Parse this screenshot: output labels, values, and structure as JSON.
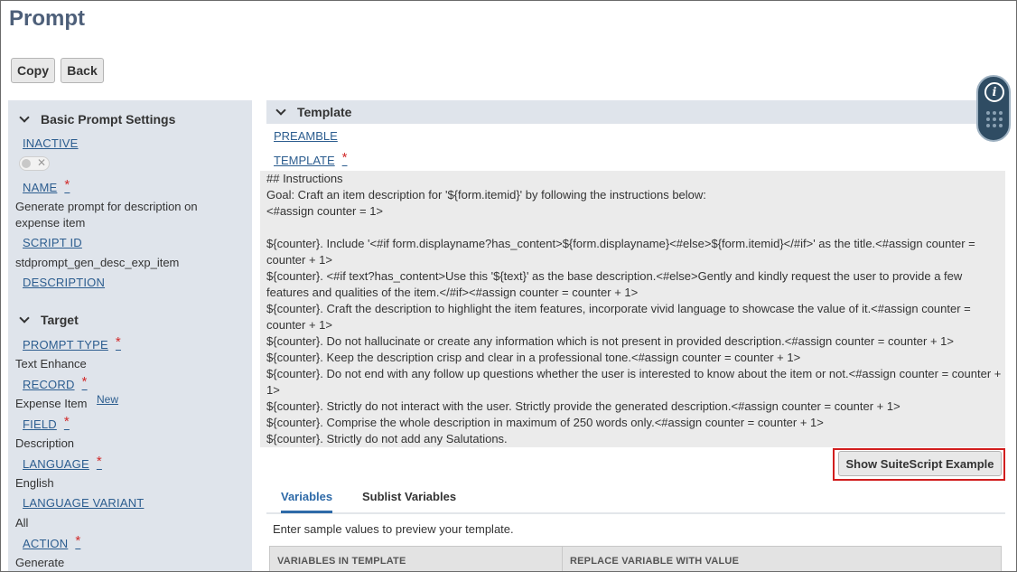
{
  "page": {
    "title": "Prompt"
  },
  "toolbar": {
    "copy_label": "Copy",
    "back_label": "Back"
  },
  "basic": {
    "heading": "Basic Prompt Settings",
    "inactive_label": "INACTIVE",
    "name_label": "NAME",
    "name_value": "Generate prompt for description on expense item",
    "script_id_label": "SCRIPT ID",
    "script_id_value": "stdprompt_gen_desc_exp_item",
    "description_label": "DESCRIPTION"
  },
  "target": {
    "heading": "Target",
    "prompt_type_label": "PROMPT TYPE",
    "prompt_type_value": "Text Enhance",
    "record_label": "RECORD",
    "record_value": "Expense Item",
    "record_new_link": "New",
    "field_label": "FIELD",
    "field_value": "Description",
    "language_label": "LANGUAGE",
    "language_value": "English",
    "language_variant_label": "LANGUAGE VARIANT",
    "language_variant_value": "All",
    "action_label": "ACTION",
    "action_value": "Generate"
  },
  "required_marker": "*",
  "template": {
    "heading": "Template",
    "preamble_label": "PREAMBLE",
    "template_label": "TEMPLATE",
    "lines": [
      "## Instructions",
      "Goal: Craft an item description for '${form.itemid}' by following the instructions below:",
      "<#assign counter = 1>",
      "",
      "${counter}. Include '<#if form.displayname?has_content>${form.displayname}<#else>${form.itemid}</#if>' as the title.<#assign counter = counter + 1>",
      "${counter}. <#if text?has_content>Use this '${text}' as the base description.<#else>Gently and kindly request the user to provide a few features and qualities of the item.</#if><#assign counter = counter + 1>",
      "${counter}. Craft the description to highlight the item features, incorporate vivid language to showcase the value of it.<#assign counter = counter + 1>",
      "${counter}. Do not hallucinate or create any information which is not present in provided description.<#assign counter = counter + 1>",
      "${counter}. Keep the description crisp and clear in a professional tone.<#assign counter = counter + 1>",
      "${counter}. Do not end with any follow up questions whether the user is interested to know about the item or not.<#assign counter = counter + 1>",
      "${counter}. Strictly do not interact with the user. Strictly provide the generated description.<#assign counter = counter + 1>",
      "${counter}. Comprise the whole description in maximum of 250 words only.<#assign counter = counter + 1>",
      "${counter}. Strictly do not add any Salutations."
    ],
    "example_button_label": "Show SuiteScript Example"
  },
  "tabs": {
    "variables": "Variables",
    "sublist_variables": "Sublist Variables"
  },
  "variables": {
    "hint": "Enter sample values to preview your template.",
    "col_1": "VARIABLES IN TEMPLATE",
    "col_2": "REPLACE VARIABLE WITH VALUE"
  },
  "icons": {
    "info": "info-icon",
    "dots": "grid-dots-icon",
    "chevron": "chevron-down-icon"
  },
  "colors": {
    "title": "#4d5f79",
    "link": "#2c5d8f",
    "required": "#d12b2b",
    "highlight": "#d11e1e",
    "panel": "#dfe4eb"
  }
}
